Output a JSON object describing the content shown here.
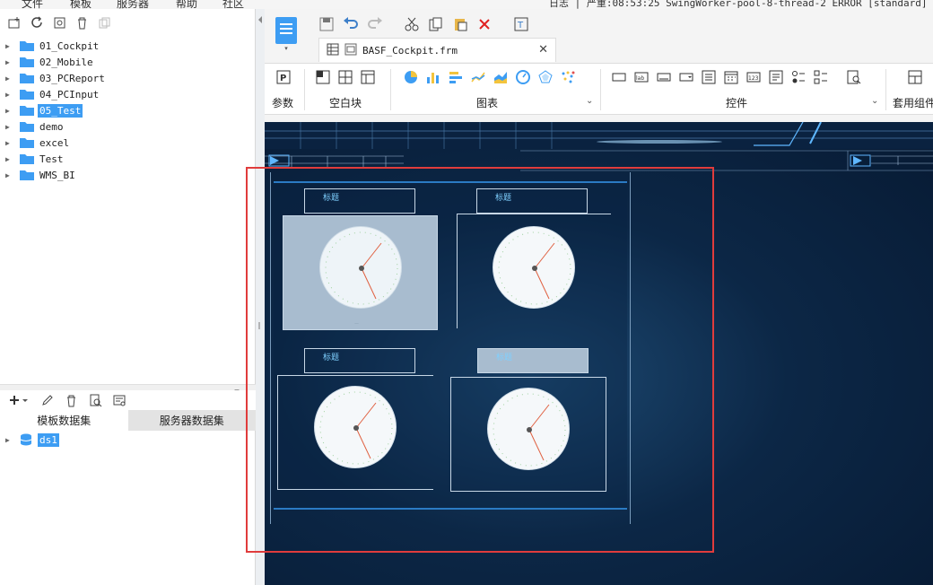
{
  "menu": {
    "items": [
      "文件",
      "模板",
      "服务器",
      "帮助",
      "社区"
    ],
    "status_log": "日志 | 严重:08:53:25 SwingWorker-pool-8-thread-2 ERROR [standard]"
  },
  "tree": {
    "items": [
      {
        "label": "01_Cockpit",
        "selected": false
      },
      {
        "label": "02_Mobile",
        "selected": false
      },
      {
        "label": "03_PCReport",
        "selected": false
      },
      {
        "label": "04_PCInput",
        "selected": false
      },
      {
        "label": "05_Test",
        "selected": true
      },
      {
        "label": "demo",
        "selected": false
      },
      {
        "label": "excel",
        "selected": false
      },
      {
        "label": "Test",
        "selected": false
      },
      {
        "label": "WMS_BI",
        "selected": false
      }
    ]
  },
  "datasets": {
    "tabs": [
      "模板数据集",
      "服务器数据集"
    ],
    "items": [
      {
        "label": "ds1",
        "selected": true
      }
    ]
  },
  "editor": {
    "file_tab": "BASF_Cockpit.frm"
  },
  "ribbon": {
    "groups": {
      "param": "参数",
      "blank": "空白块",
      "chart": "图表",
      "control": "控件",
      "component": "套用组件"
    }
  },
  "canvas": {
    "widgets": [
      {
        "title": "标题"
      },
      {
        "title": "标题"
      },
      {
        "title": "标题"
      },
      {
        "title": "标题"
      }
    ]
  },
  "colors": {
    "selection": "#3d9df3",
    "folder": "#3d9df3",
    "canvas_dark": "#0c2746",
    "highlight_box": "#e03c3c"
  }
}
